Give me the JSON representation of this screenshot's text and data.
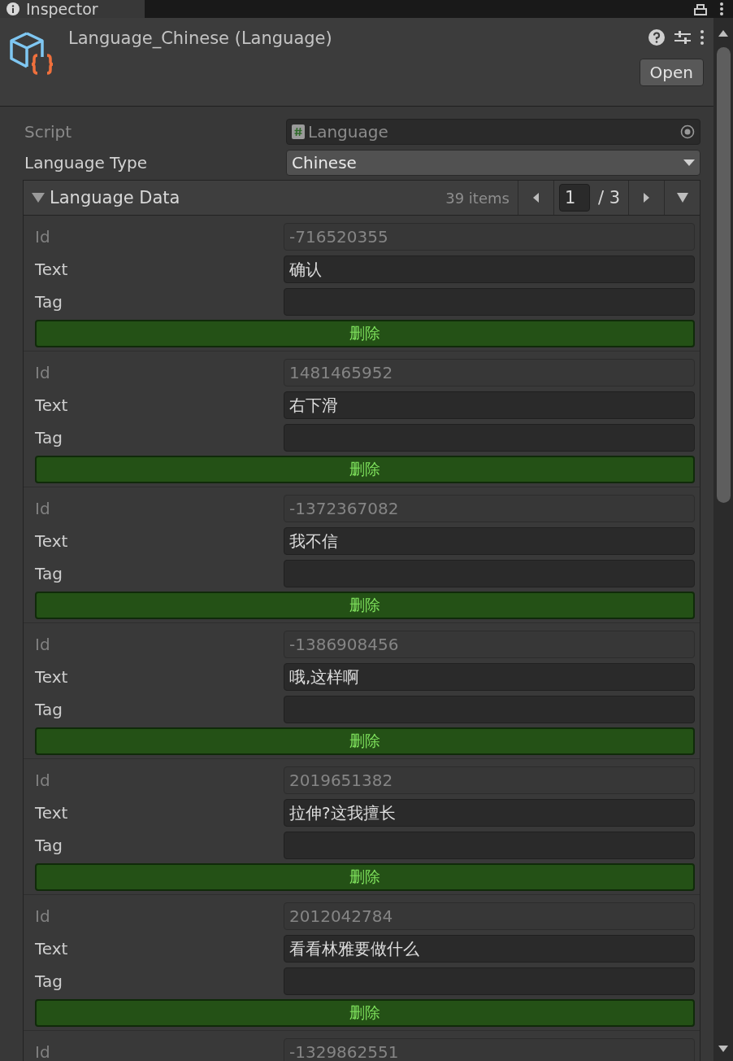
{
  "tab": {
    "title": "Inspector"
  },
  "header": {
    "title": "Language_Chinese (Language)",
    "open_button": "Open"
  },
  "properties": [
    {
      "kind": "object",
      "label": "Script",
      "value": "Language",
      "disabled": true
    },
    {
      "kind": "dropdown",
      "label": "Language Type",
      "value": "Chinese",
      "disabled": false
    }
  ],
  "array": {
    "title": "Language Data",
    "expanded": true,
    "count": "39 items",
    "page": "1",
    "page_total": "/ 3",
    "entries": [
      {
        "fields": [
          {
            "label": "Id",
            "value": "-716520355",
            "disabled": true
          },
          {
            "label": "Text",
            "value": "确认",
            "disabled": false
          },
          {
            "label": "Tag",
            "disabled": false
          }
        ],
        "button": "删除"
      },
      {
        "fields": [
          {
            "label": "Id",
            "value": "1481465952",
            "disabled": true
          },
          {
            "label": "Text",
            "value": "右下滑",
            "disabled": false
          },
          {
            "label": "Tag",
            "disabled": false
          }
        ],
        "button": "删除"
      },
      {
        "fields": [
          {
            "label": "Id",
            "value": "-1372367082",
            "disabled": true
          },
          {
            "label": "Text",
            "value": "我不信",
            "disabled": false
          },
          {
            "label": "Tag",
            "disabled": false
          }
        ],
        "button": "删除"
      },
      {
        "fields": [
          {
            "label": "Id",
            "value": "-1386908456",
            "disabled": true
          },
          {
            "label": "Text",
            "value": "哦,这样啊",
            "disabled": false
          },
          {
            "label": "Tag",
            "disabled": false
          }
        ],
        "button": "删除"
      },
      {
        "fields": [
          {
            "label": "Id",
            "value": "2019651382",
            "disabled": true
          },
          {
            "label": "Text",
            "value": "拉伸?这我擅长",
            "disabled": false
          },
          {
            "label": "Tag",
            "disabled": false
          }
        ],
        "button": "删除"
      },
      {
        "fields": [
          {
            "label": "Id",
            "value": "2012042784",
            "disabled": true
          },
          {
            "label": "Text",
            "value": "看看林雅要做什么",
            "disabled": false
          },
          {
            "label": "Tag",
            "disabled": false
          }
        ],
        "button": "删除"
      },
      {
        "fields": [
          {
            "label": "Id",
            "value": "-1329862551",
            "disabled": true
          }
        ]
      }
    ]
  }
}
